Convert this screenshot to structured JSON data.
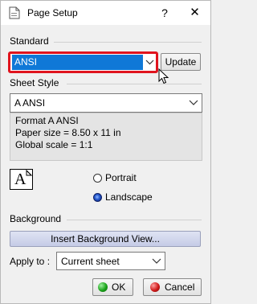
{
  "window": {
    "title": "Page Setup",
    "help_glyph": "?",
    "close_glyph": "✕"
  },
  "standard": {
    "section_label": "Standard",
    "selected_value": "ANSI",
    "update_button": "Update"
  },
  "sheet_style": {
    "section_label": "Sheet Style",
    "selected_value": "A ANSI",
    "format_lines": [
      "Format A ANSI",
      "Paper size = 8.50 x 11 in",
      "Global scale = 1:1"
    ]
  },
  "orientation": {
    "icon_glyph": "A",
    "options": [
      {
        "label": "Portrait",
        "selected": false
      },
      {
        "label": "Landscape",
        "selected": true
      }
    ]
  },
  "background": {
    "section_label": "Background",
    "insert_button": "Insert Background View...",
    "apply_to_label": "Apply to :",
    "apply_to_value": "Current sheet"
  },
  "footer": {
    "ok_label": "OK",
    "cancel_label": "Cancel"
  },
  "colors": {
    "highlight_border": "#e0141e",
    "selection_bg": "#0f78d7",
    "ok_icon": "#1aa31a",
    "cancel_icon": "#d01a1a"
  }
}
